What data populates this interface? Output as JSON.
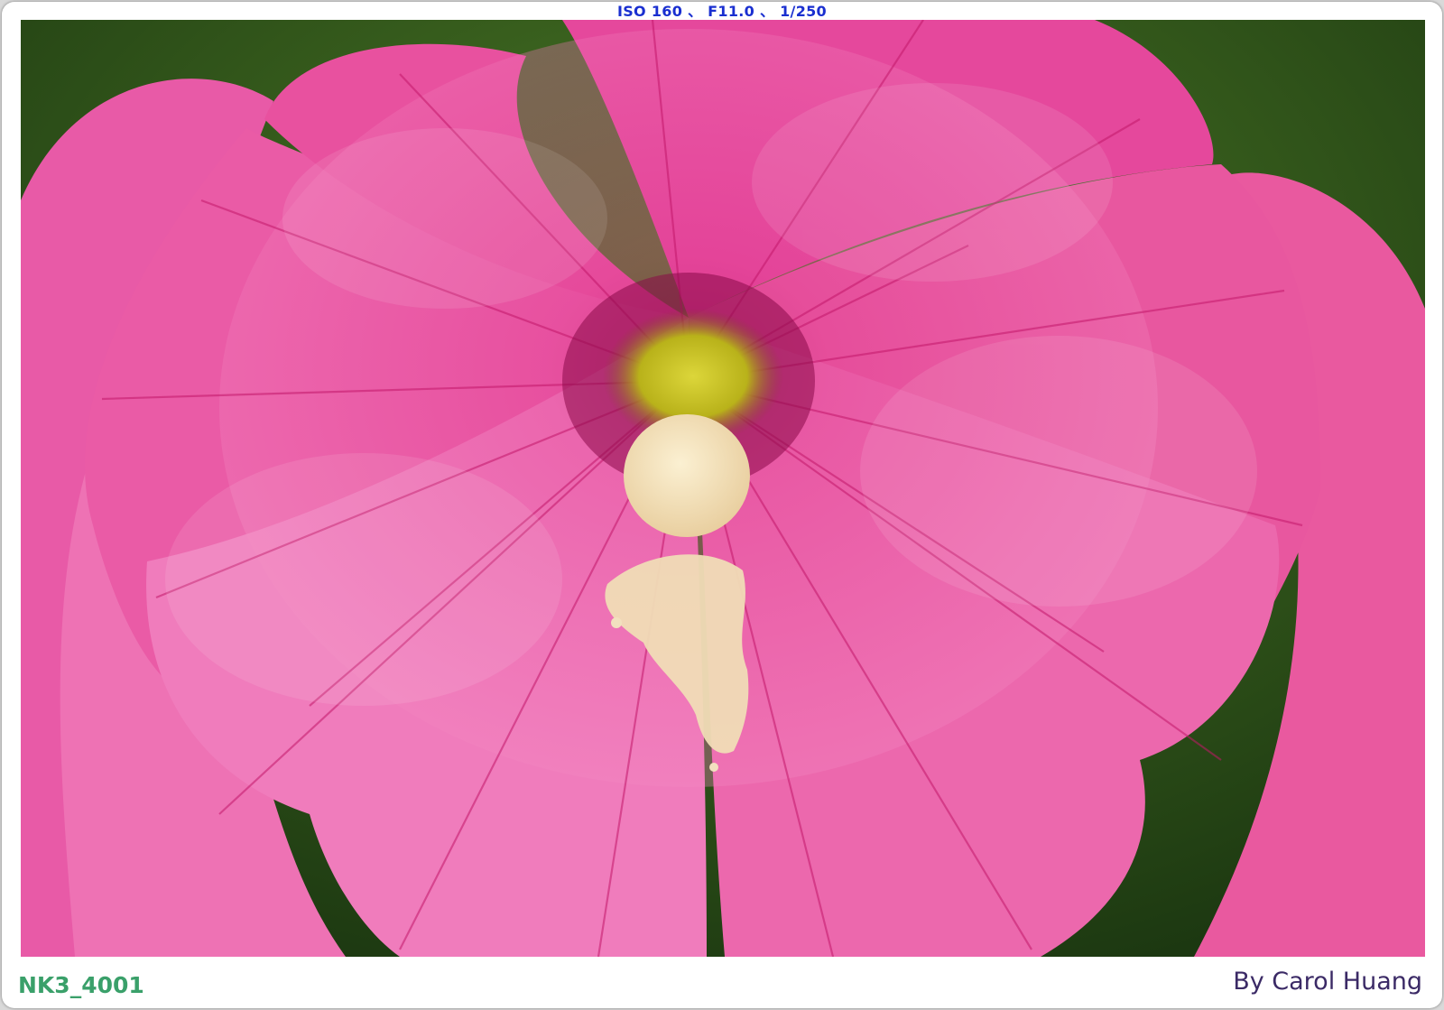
{
  "header": {
    "exif": "ISO 160 、 F11.0 、 1/250"
  },
  "photo": {
    "subject": "pink-hollyhock-flower",
    "colors": {
      "petal": "#e64a9e",
      "petal_light": "#f58fc6",
      "vein": "#c8186a",
      "center": "#c9c623",
      "pollen": "#f4e1bd",
      "background": "#2f5a1a"
    }
  },
  "footer": {
    "filename": "NK3_4001",
    "credit": "By Carol Huang"
  }
}
